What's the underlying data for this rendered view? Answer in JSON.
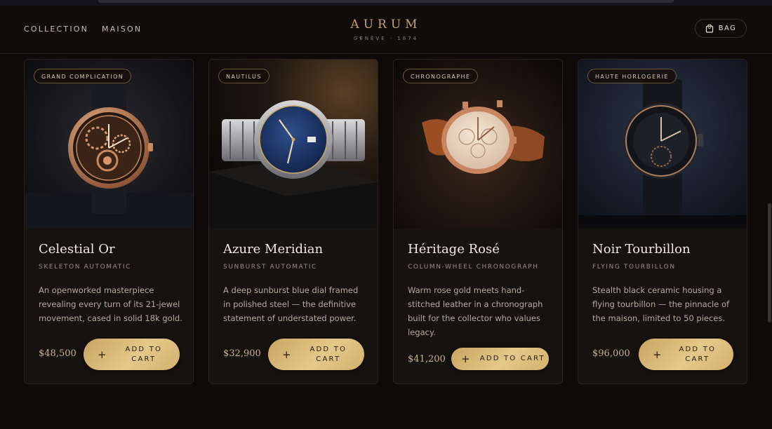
{
  "nav": {
    "left_links": [
      "COLLECTION",
      "MAISON"
    ],
    "logo": "AURUM",
    "logo_sub": "GENÈVE · 1874",
    "bag_label": "BAG",
    "bag_icon": "bag-icon"
  },
  "products": [
    {
      "badge": "GRAND COMPLICATION",
      "title": "Celestial Or",
      "subtitle": "SKELETON AUTOMATIC",
      "description": "An openworked masterpiece revealing every turn of its 21-jewel movement, cased in solid 18k gold.",
      "price": "$48,500",
      "button_label": "ADD TO CART",
      "image": "skeleton-watch-rose-gold"
    },
    {
      "badge": "NAUTILUS",
      "title": "Azure Meridian",
      "subtitle": "SUNBURST AUTOMATIC",
      "description": "A deep sunburst blue dial framed in polished steel — the definitive statement of understated power.",
      "price": "$32,900",
      "button_label": "ADD TO CART",
      "image": "blue-dial-steel-watch"
    },
    {
      "badge": "CHRONOGRAPHE",
      "title": "Héritage Rosé",
      "subtitle": "COLUMN-WHEEL CHRONOGRAPH",
      "description": "Warm rose gold meets hand-stitched leather in a chronograph built for the collector who values legacy.",
      "price": "$41,200",
      "button_label": "ADD TO CART",
      "image": "rose-gold-chronograph-watch"
    },
    {
      "badge": "HAUTE HORLOGERIE",
      "title": "Noir Tourbillon",
      "subtitle": "FLYING TOURBILLON",
      "description": "Stealth black ceramic housing a flying tourbillon — the pinnacle of the maison, limited to 50 pieces.",
      "price": "$96,000",
      "button_label": "ADD TO CART",
      "image": "black-ceramic-tourbillon-watch"
    }
  ],
  "colors": {
    "background": "#0d0a09",
    "card": "#161210",
    "gold_accent": "#c9a46c",
    "button_gold": "#e4c98a"
  }
}
